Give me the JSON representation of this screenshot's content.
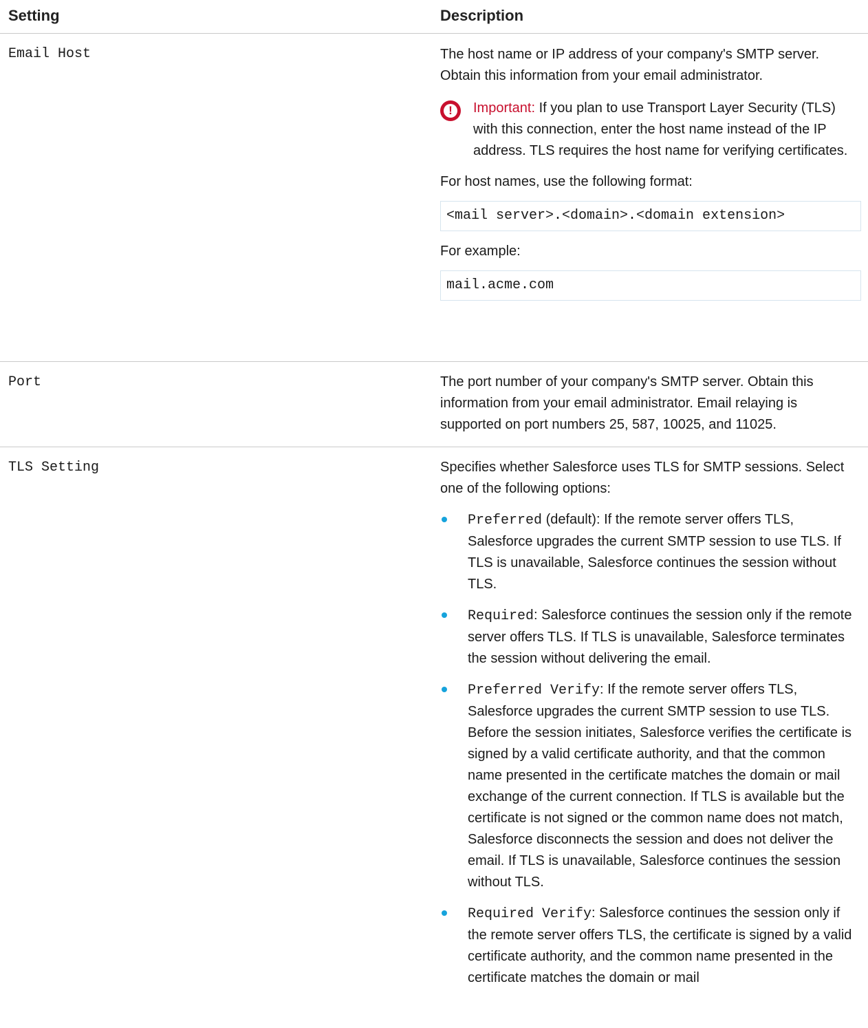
{
  "header": {
    "setting": "Setting",
    "description": "Description"
  },
  "rows": [
    {
      "setting": "Email Host",
      "description": "The host name or IP address of your company's SMTP server. Obtain this information from your email administrator.",
      "important_label": "Important:",
      "important_text": " If you plan to use Transport Layer Security (TLS) with this connection, enter the host name instead of the IP address. TLS requires the host name for verifying certificates.",
      "format_intro": "For host names, use the following format:",
      "format_code": "<mail server>.<domain>.<domain extension>",
      "example_intro": "For example:",
      "example_code": "mail.acme.com"
    },
    {
      "setting": "Port",
      "description": "The port number of your company's SMTP server. Obtain this information from your email administrator. Email relaying is supported on port numbers 25, 587, 10025, and 11025."
    },
    {
      "setting": "TLS Setting",
      "description": "Specifies whether Salesforce uses TLS for SMTP sessions. Select one of the following options:",
      "options": [
        {
          "code": "Preferred",
          "text": " (default): If the remote server offers TLS, Salesforce upgrades the current SMTP session to use TLS. If TLS is unavailable, Salesforce continues the session without TLS."
        },
        {
          "code": "Required",
          "text": ": Salesforce continues the session only if the remote server offers TLS. If TLS is unavailable, Salesforce terminates the session without delivering the email."
        },
        {
          "code": "Preferred Verify",
          "text": ": If the remote server offers TLS, Salesforce upgrades the current SMTP session to use TLS. Before the session initiates, Salesforce verifies the certificate is signed by a valid certificate authority, and that the common name presented in the certificate matches the domain or mail exchange of the current connection. If TLS is available but the certificate is not signed or the common name does not match, Salesforce disconnects the session and does not deliver the email. If TLS is unavailable, Salesforce continues the session without TLS."
        },
        {
          "code": "Required Verify",
          "text": ": Salesforce continues the session only if the remote server offers TLS, the certificate is signed by a valid certificate authority, and the common name presented in the certificate matches the domain or mail"
        }
      ]
    }
  ],
  "colors": {
    "important": "#c8102e",
    "bullet": "#16a3dc",
    "rule": "#c9c9c9",
    "codebox_border": "#d6e4ee"
  },
  "icons": {
    "important": "exclamation-circle-icon"
  }
}
